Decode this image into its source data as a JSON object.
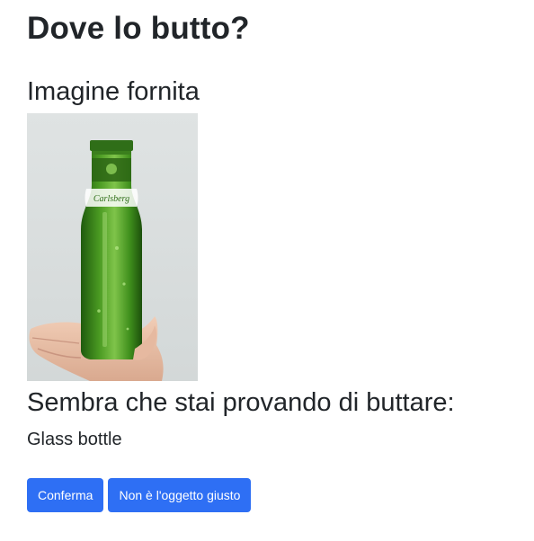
{
  "page": {
    "title": "Dove lo butto?",
    "provided_image_heading": "Imagine fornita",
    "guess_heading": "Sembra che stai provando di buttare:",
    "detected_object": "Glass bottle"
  },
  "image": {
    "subject": "hand-holding-green-beer-bottle",
    "label_text": "Carlsberg",
    "colors": {
      "background": "#d9dddd",
      "bottle": "#3f8f1c",
      "bottle_highlight": "#7fc44a",
      "cap": "#2f6e18",
      "skin": "#e9c2ab"
    }
  },
  "actions": {
    "confirm_label": "Conferma",
    "wrong_object_label": "Non è l'oggetto giusto"
  },
  "colors": {
    "button": "#2e6ff4",
    "text": "#212529"
  }
}
